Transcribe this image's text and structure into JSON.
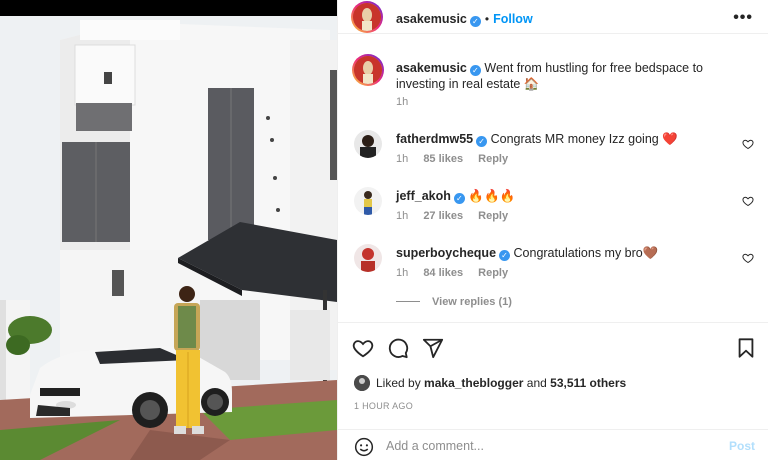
{
  "post": {
    "author": "asakemusic",
    "follow_label": "Follow",
    "separator": "•",
    "more_label": "•••"
  },
  "caption": {
    "author": "asakemusic",
    "text": "Went from hustling for free bedspace to investing in real estate 🏠",
    "time": "1h"
  },
  "comments": [
    {
      "user": "fatherdmw55",
      "text": "Congrats MR money Izz going ❤️",
      "time": "1h",
      "likes": "85 likes",
      "reply": "Reply"
    },
    {
      "user": "jeff_akoh",
      "text": "🔥🔥🔥",
      "time": "1h",
      "likes": "27 likes",
      "reply": "Reply"
    },
    {
      "user": "superboycheque",
      "text": "Congratulations my bro🤎",
      "time": "1h",
      "likes": "84 likes",
      "reply": "Reply"
    }
  ],
  "view_replies": "View replies (1)",
  "likes": {
    "prefix": "Liked by",
    "user": "maka_theblogger",
    "and": "and",
    "count": "53,511 others"
  },
  "timestamp": "1 HOUR AGO",
  "add_comment": {
    "placeholder": "Add a comment...",
    "post_label": "Post"
  },
  "colors": {
    "link_blue": "#0095f6",
    "verified_blue": "#3897f0",
    "muted": "#8e8e8e",
    "post_disabled": "#b2dffc"
  }
}
